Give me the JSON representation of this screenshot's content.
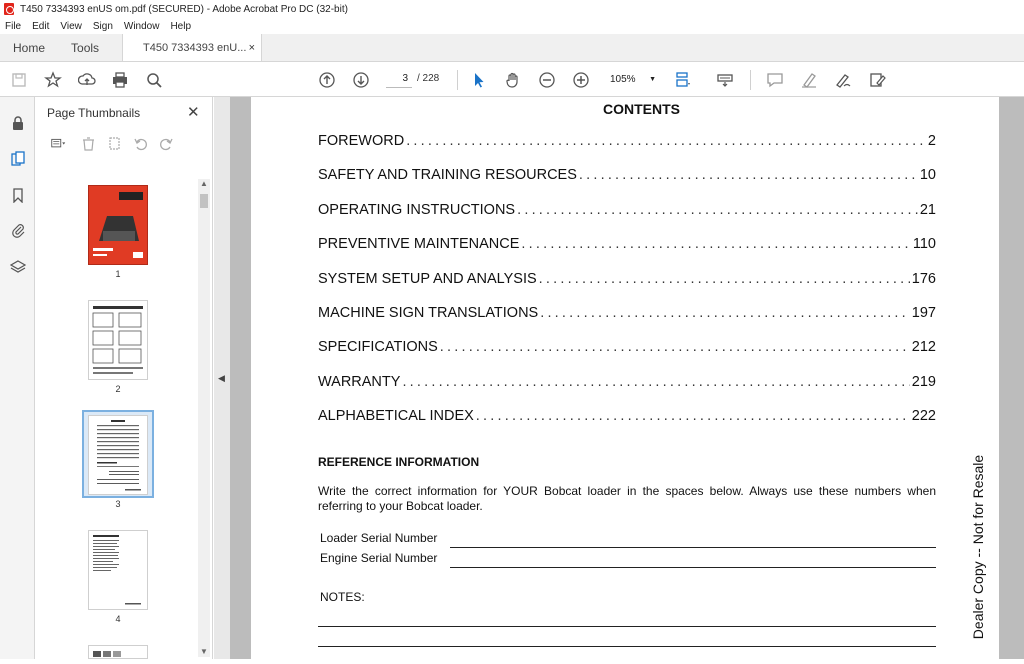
{
  "window": {
    "title": "T450 7334393 enUS om.pdf (SECURED) - Adobe Acrobat Pro DC (32-bit)"
  },
  "menu": [
    "File",
    "Edit",
    "View",
    "Sign",
    "Window",
    "Help"
  ],
  "tabs": {
    "home": "Home",
    "tools": "Tools",
    "document": "T450 7334393 enU...",
    "close": "×"
  },
  "toolbar": {
    "page_current": "3",
    "page_total": "/ 228",
    "zoom": "105%",
    "icons": [
      "save-icon",
      "bookmark-star-icon",
      "upload-icon",
      "print-icon",
      "search-icon",
      "page-up-icon",
      "page-down-icon",
      "select-arrow-icon",
      "hand-icon",
      "zoom-out-icon",
      "zoom-in-icon",
      "fit-page-icon",
      "keyboard-icon",
      "comment-icon",
      "highlight-icon",
      "sign-icon",
      "edit-icon"
    ]
  },
  "rail": {
    "icons": [
      "lock-icon",
      "pages-icon",
      "bookmark-icon",
      "attachment-icon",
      "layers-icon"
    ]
  },
  "thumbnails": {
    "title": "Page Thumbnails",
    "close": "✕",
    "pages": [
      {
        "label": "1"
      },
      {
        "label": "2"
      },
      {
        "label": "3",
        "selected": true
      },
      {
        "label": "4"
      }
    ]
  },
  "document": {
    "contents_title": "CONTENTS",
    "toc": [
      {
        "label": "FOREWORD",
        "page": "2"
      },
      {
        "label": "SAFETY AND TRAINING RESOURCES",
        "page": "10"
      },
      {
        "label": "OPERATING INSTRUCTIONS",
        "page": "21"
      },
      {
        "label": "PREVENTIVE MAINTENANCE",
        "page": "110"
      },
      {
        "label": "SYSTEM SETUP AND ANALYSIS",
        "page": "176"
      },
      {
        "label": "MACHINE SIGN TRANSLATIONS",
        "page": "197"
      },
      {
        "label": "SPECIFICATIONS",
        "page": "212"
      },
      {
        "label": "WARRANTY",
        "page": "219"
      },
      {
        "label": "ALPHABETICAL INDEX",
        "page": "222"
      }
    ],
    "reference_title": "REFERENCE INFORMATION",
    "reference_text": "Write the correct information for YOUR Bobcat loader in the spaces below. Always use these numbers when referring to your Bobcat loader.",
    "fields": {
      "loader_serial": "Loader Serial Number",
      "engine_serial": "Engine Serial Number"
    },
    "notes_label": "NOTES:",
    "watermark": "Dealer Copy -- Not for Resale"
  }
}
